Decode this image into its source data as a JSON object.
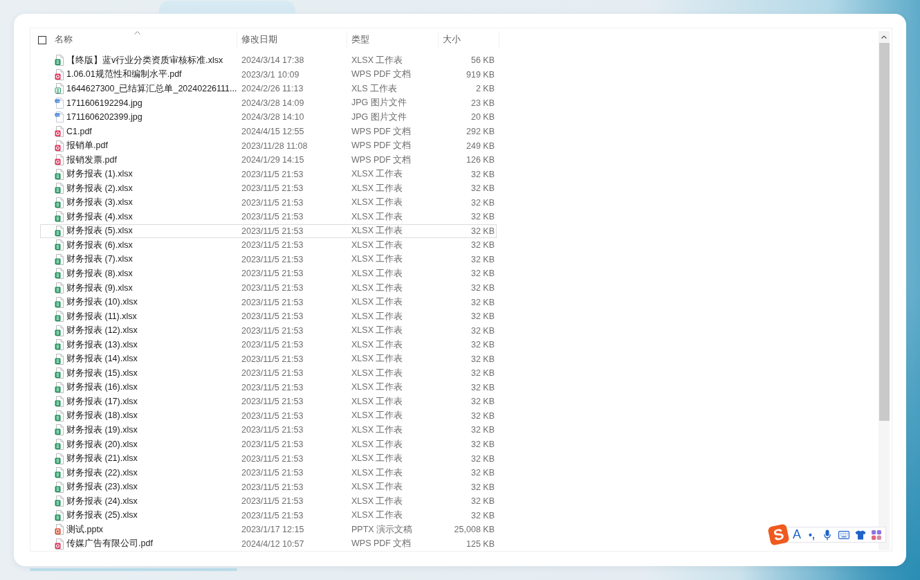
{
  "columns": [
    {
      "label": "名称",
      "sorted": true
    },
    {
      "label": "修改日期",
      "sorted": false
    },
    {
      "label": "类型",
      "sorted": false
    },
    {
      "label": "大小",
      "sorted": false
    }
  ],
  "select_all": {
    "checked": false
  },
  "files": [
    {
      "name": "【终版】蓝v行业分类资质审核标准.xlsx",
      "modified": "2024/3/14 17:38",
      "type": "XLSX 工作表",
      "size": "56 KB",
      "kind": "xlsx",
      "hovered": false
    },
    {
      "name": "1.06.01规范性和编制水平.pdf",
      "modified": "2023/3/1 10:09",
      "type": "WPS PDF 文档",
      "size": "919 KB",
      "kind": "pdf",
      "hovered": false
    },
    {
      "name": "1644627300_已结算汇总单_20240226111...",
      "modified": "2024/2/26 11:13",
      "type": "XLS 工作表",
      "size": "2 KB",
      "kind": "xls",
      "hovered": false
    },
    {
      "name": "1711606192294.jpg",
      "modified": "2024/3/28 14:09",
      "type": "JPG 图片文件",
      "size": "23 KB",
      "kind": "jpg",
      "hovered": false
    },
    {
      "name": "1711606202399.jpg",
      "modified": "2024/3/28 14:10",
      "type": "JPG 图片文件",
      "size": "20 KB",
      "kind": "jpg",
      "hovered": false
    },
    {
      "name": "C1.pdf",
      "modified": "2024/4/15 12:55",
      "type": "WPS PDF 文档",
      "size": "292 KB",
      "kind": "pdf",
      "hovered": false
    },
    {
      "name": "报销单.pdf",
      "modified": "2023/11/28 11:08",
      "type": "WPS PDF 文档",
      "size": "249 KB",
      "kind": "pdf",
      "hovered": false
    },
    {
      "name": "报销发票.pdf",
      "modified": "2024/1/29 14:15",
      "type": "WPS PDF 文档",
      "size": "126 KB",
      "kind": "pdf",
      "hovered": false
    },
    {
      "name": "财务报表 (1).xlsx",
      "modified": "2023/11/5 21:53",
      "type": "XLSX 工作表",
      "size": "32 KB",
      "kind": "xlsx",
      "hovered": false
    },
    {
      "name": "财务报表 (2).xlsx",
      "modified": "2023/11/5 21:53",
      "type": "XLSX 工作表",
      "size": "32 KB",
      "kind": "xlsx",
      "hovered": false
    },
    {
      "name": "财务报表 (3).xlsx",
      "modified": "2023/11/5 21:53",
      "type": "XLSX 工作表",
      "size": "32 KB",
      "kind": "xlsx",
      "hovered": false
    },
    {
      "name": "财务报表 (4).xlsx",
      "modified": "2023/11/5 21:53",
      "type": "XLSX 工作表",
      "size": "32 KB",
      "kind": "xlsx",
      "hovered": false
    },
    {
      "name": "财务报表 (5).xlsx",
      "modified": "2023/11/5 21:53",
      "type": "XLSX 工作表",
      "size": "32 KB",
      "kind": "xlsx",
      "hovered": true
    },
    {
      "name": "财务报表 (6).xlsx",
      "modified": "2023/11/5 21:53",
      "type": "XLSX 工作表",
      "size": "32 KB",
      "kind": "xlsx",
      "hovered": false
    },
    {
      "name": "财务报表 (7).xlsx",
      "modified": "2023/11/5 21:53",
      "type": "XLSX 工作表",
      "size": "32 KB",
      "kind": "xlsx",
      "hovered": false
    },
    {
      "name": "财务报表 (8).xlsx",
      "modified": "2023/11/5 21:53",
      "type": "XLSX 工作表",
      "size": "32 KB",
      "kind": "xlsx",
      "hovered": false
    },
    {
      "name": "财务报表 (9).xlsx",
      "modified": "2023/11/5 21:53",
      "type": "XLSX 工作表",
      "size": "32 KB",
      "kind": "xlsx",
      "hovered": false
    },
    {
      "name": "财务报表 (10).xlsx",
      "modified": "2023/11/5 21:53",
      "type": "XLSX 工作表",
      "size": "32 KB",
      "kind": "xlsx",
      "hovered": false
    },
    {
      "name": "财务报表 (11).xlsx",
      "modified": "2023/11/5 21:53",
      "type": "XLSX 工作表",
      "size": "32 KB",
      "kind": "xlsx",
      "hovered": false
    },
    {
      "name": "财务报表 (12).xlsx",
      "modified": "2023/11/5 21:53",
      "type": "XLSX 工作表",
      "size": "32 KB",
      "kind": "xlsx",
      "hovered": false
    },
    {
      "name": "财务报表 (13).xlsx",
      "modified": "2023/11/5 21:53",
      "type": "XLSX 工作表",
      "size": "32 KB",
      "kind": "xlsx",
      "hovered": false
    },
    {
      "name": "财务报表 (14).xlsx",
      "modified": "2023/11/5 21:53",
      "type": "XLSX 工作表",
      "size": "32 KB",
      "kind": "xlsx",
      "hovered": false
    },
    {
      "name": "财务报表 (15).xlsx",
      "modified": "2023/11/5 21:53",
      "type": "XLSX 工作表",
      "size": "32 KB",
      "kind": "xlsx",
      "hovered": false
    },
    {
      "name": "财务报表 (16).xlsx",
      "modified": "2023/11/5 21:53",
      "type": "XLSX 工作表",
      "size": "32 KB",
      "kind": "xlsx",
      "hovered": false
    },
    {
      "name": "财务报表 (17).xlsx",
      "modified": "2023/11/5 21:53",
      "type": "XLSX 工作表",
      "size": "32 KB",
      "kind": "xlsx",
      "hovered": false
    },
    {
      "name": "财务报表 (18).xlsx",
      "modified": "2023/11/5 21:53",
      "type": "XLSX 工作表",
      "size": "32 KB",
      "kind": "xlsx",
      "hovered": false
    },
    {
      "name": "财务报表 (19).xlsx",
      "modified": "2023/11/5 21:53",
      "type": "XLSX 工作表",
      "size": "32 KB",
      "kind": "xlsx",
      "hovered": false
    },
    {
      "name": "财务报表 (20).xlsx",
      "modified": "2023/11/5 21:53",
      "type": "XLSX 工作表",
      "size": "32 KB",
      "kind": "xlsx",
      "hovered": false
    },
    {
      "name": "财务报表 (21).xlsx",
      "modified": "2023/11/5 21:53",
      "type": "XLSX 工作表",
      "size": "32 KB",
      "kind": "xlsx",
      "hovered": false
    },
    {
      "name": "财务报表 (22).xlsx",
      "modified": "2023/11/5 21:53",
      "type": "XLSX 工作表",
      "size": "32 KB",
      "kind": "xlsx",
      "hovered": false
    },
    {
      "name": "财务报表 (23).xlsx",
      "modified": "2023/11/5 21:53",
      "type": "XLSX 工作表",
      "size": "32 KB",
      "kind": "xlsx",
      "hovered": false
    },
    {
      "name": "财务报表 (24).xlsx",
      "modified": "2023/11/5 21:53",
      "type": "XLSX 工作表",
      "size": "32 KB",
      "kind": "xlsx",
      "hovered": false
    },
    {
      "name": "财务报表 (25).xlsx",
      "modified": "2023/11/5 21:53",
      "type": "XLSX 工作表",
      "size": "32 KB",
      "kind": "xlsx",
      "hovered": false
    },
    {
      "name": "测试.pptx",
      "modified": "2023/1/17 12:15",
      "type": "PPTX 演示文稿",
      "size": "25,008 KB",
      "kind": "pptx",
      "hovered": false
    },
    {
      "name": "传媒广告有限公司.pdf",
      "modified": "2024/4/12 10:57",
      "type": "WPS PDF 文档",
      "size": "125 KB",
      "kind": "pdf",
      "hovered": false
    }
  ],
  "ime_toolbar": {
    "logo": "S",
    "mode": "A",
    "punctuation": "•,"
  }
}
